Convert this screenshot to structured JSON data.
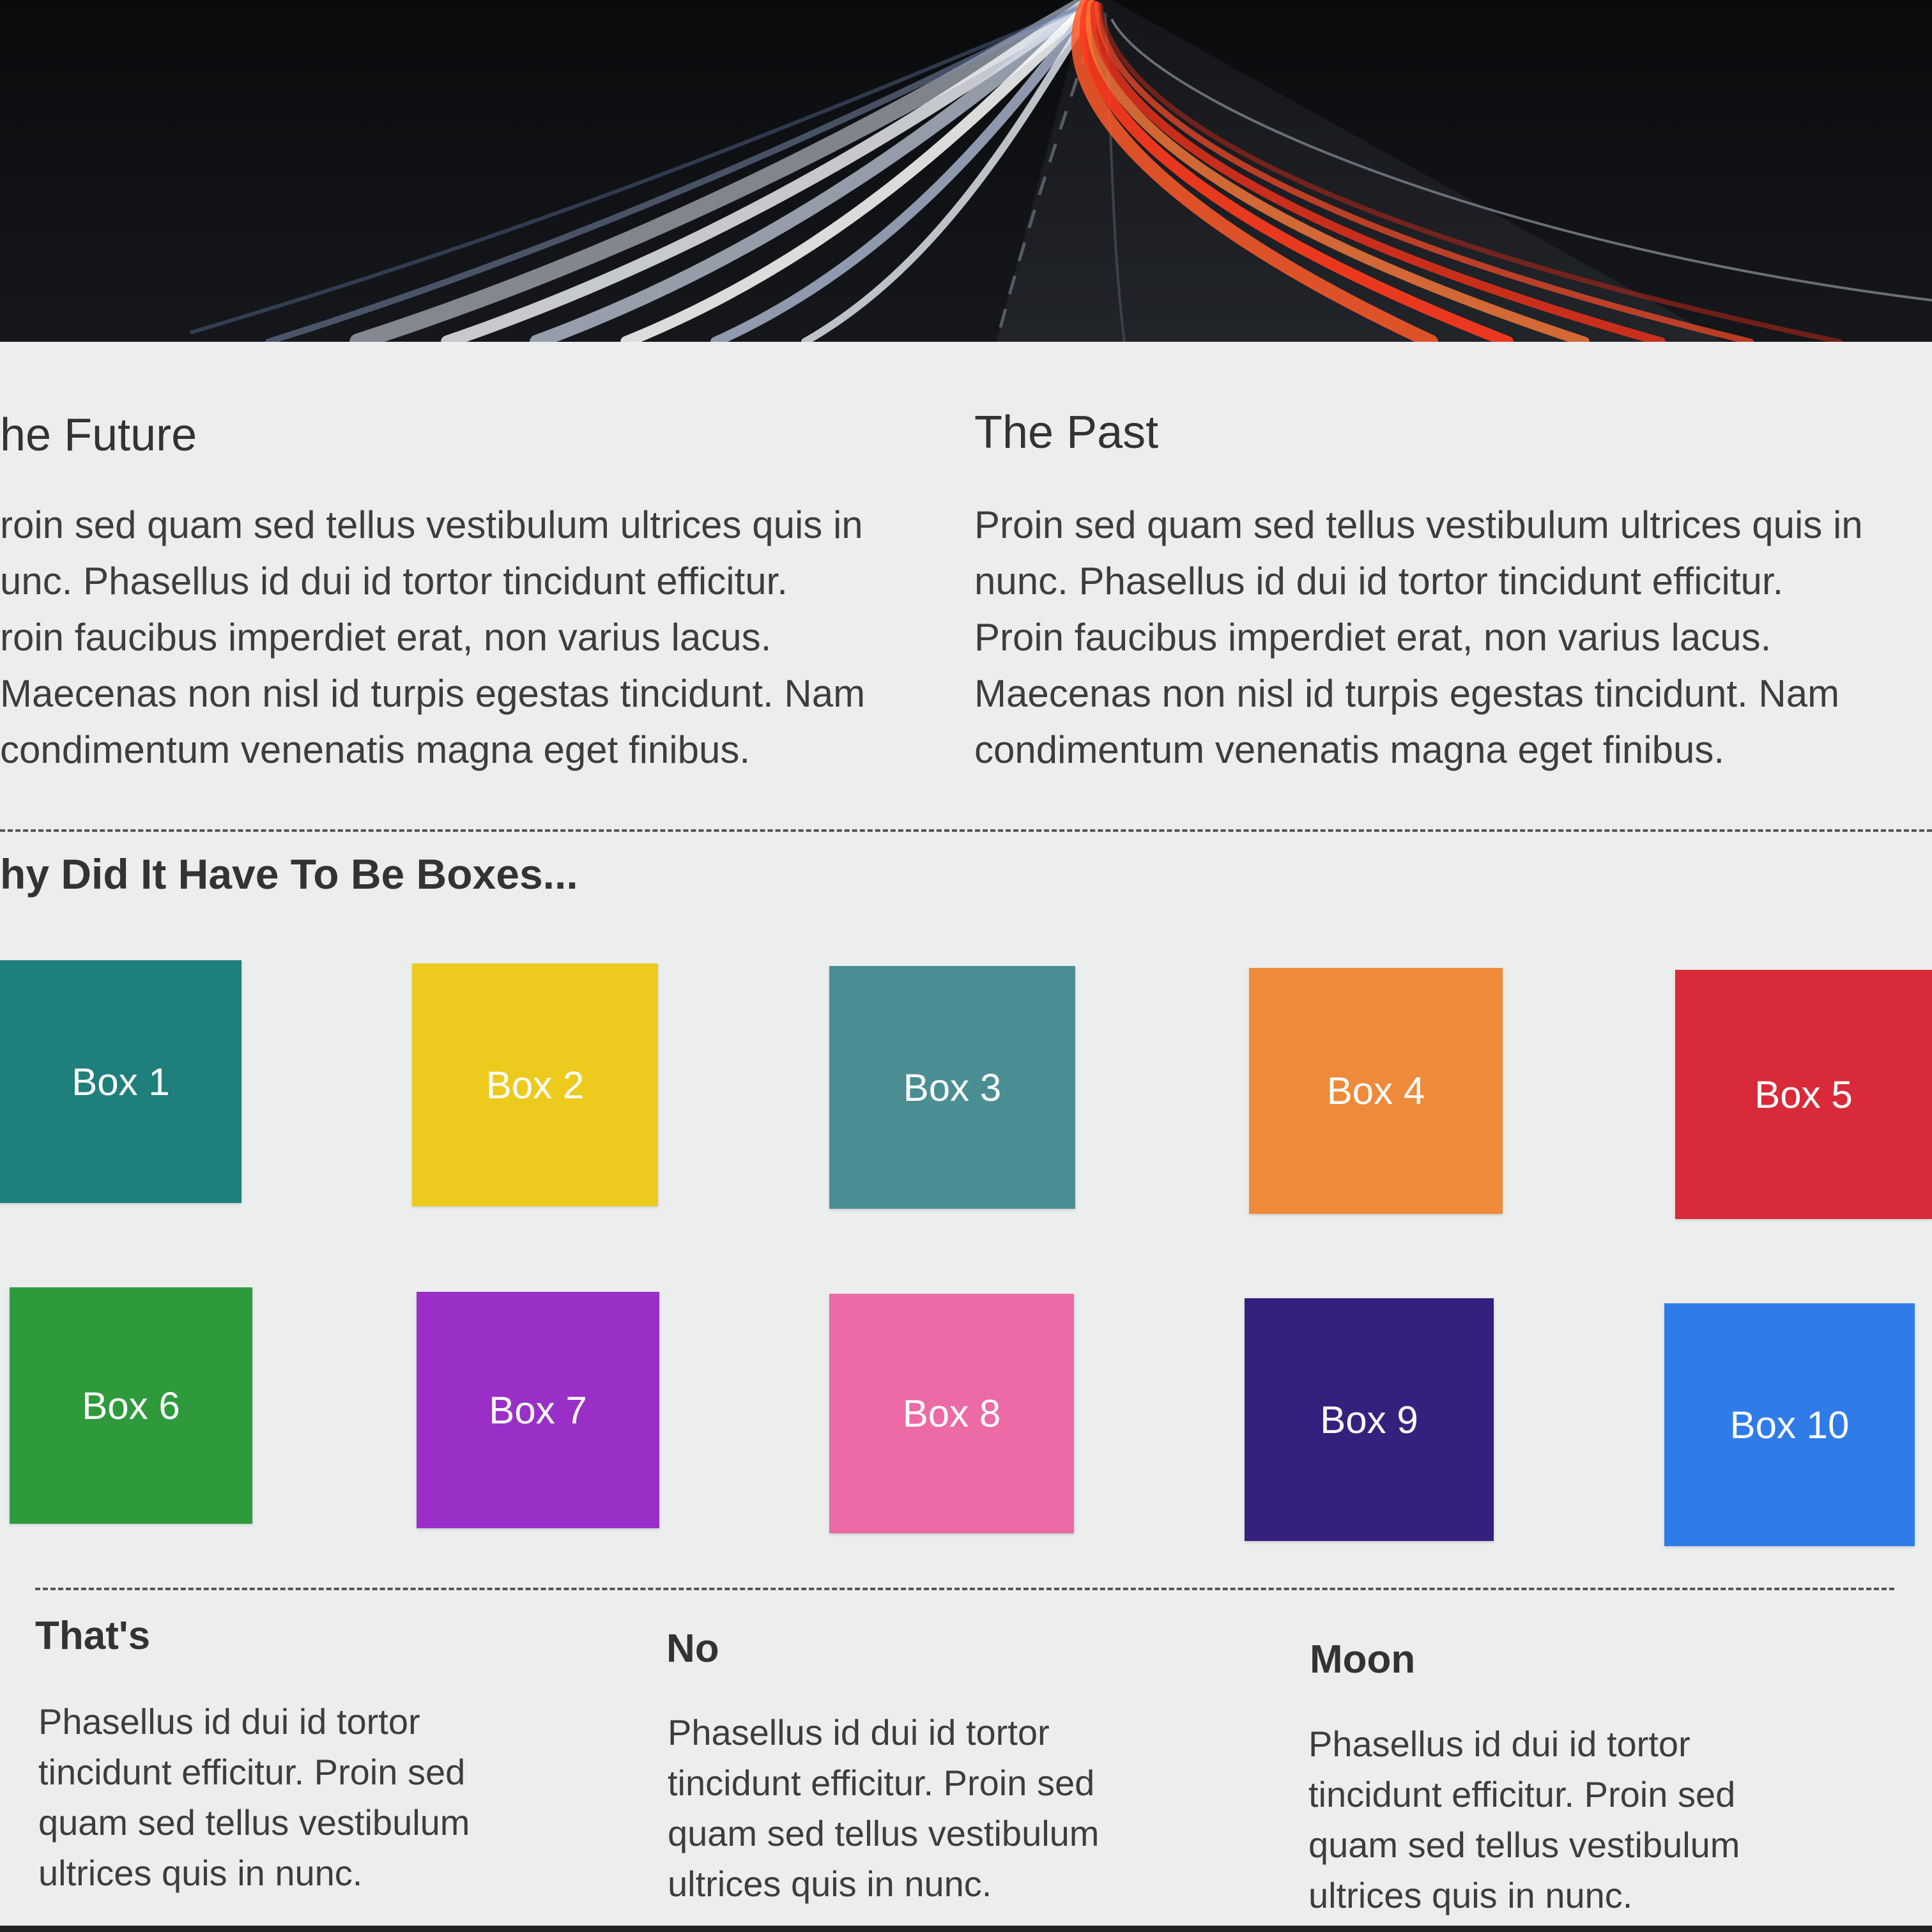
{
  "hero": {
    "image_icon": "highway-light-trails-image"
  },
  "intro": {
    "left": {
      "title": "he Future",
      "lines": [
        "roin sed quam sed tellus vestibulum ultrices quis in",
        "unc. Phasellus id dui id tortor tincidunt efficitur.",
        "roin faucibus imperdiet erat, non varius lacus.",
        "Maecenas non nisl id turpis egestas tincidunt. Nam",
        "condimentum venenatis magna eget finibus."
      ]
    },
    "right": {
      "title": "The Past",
      "lines": [
        "Proin sed quam sed tellus vestibulum ultrices quis in",
        "nunc. Phasellus id dui id tortor tincidunt efficitur.",
        "Proin faucibus imperdiet erat, non varius lacus.",
        "Maecenas non nisl id turpis egestas tincidunt. Nam",
        "condimentum venenatis magna eget finibus."
      ]
    }
  },
  "boxes_section": {
    "title": "hy Did It Have To Be Boxes...",
    "boxes": [
      {
        "label": "Box 1",
        "color": "#1f7f7a"
      },
      {
        "label": "Box 2",
        "color": "#eccb1e"
      },
      {
        "label": "Box 3",
        "color": "#4a8e93"
      },
      {
        "label": "Box 4",
        "color": "#ee8a3a"
      },
      {
        "label": "Box 5",
        "color": "#d92a3a"
      },
      {
        "label": "Box 6",
        "color": "#2e9a3c"
      },
      {
        "label": "Box 7",
        "color": "#9a2fc8"
      },
      {
        "label": "Box 8",
        "color": "#ec6aa6"
      },
      {
        "label": "Box 9",
        "color": "#36207e"
      },
      {
        "label": "Box 10",
        "color": "#2f7ce8"
      }
    ]
  },
  "footer_columns": [
    {
      "title": "That's",
      "lines": [
        "Phasellus id dui id tortor",
        "tincidunt efficitur. Proin sed",
        "quam sed tellus vestibulum",
        "ultrices quis in nunc."
      ]
    },
    {
      "title": "No",
      "lines": [
        "Phasellus id dui id tortor",
        "tincidunt efficitur. Proin sed",
        "quam sed tellus vestibulum",
        "ultrices quis in nunc."
      ]
    },
    {
      "title": "Moon",
      "lines": [
        "Phasellus id dui id tortor",
        "tincidunt efficitur. Proin sed",
        "quam sed tellus vestibulum",
        "ultrices quis in nunc."
      ]
    }
  ]
}
